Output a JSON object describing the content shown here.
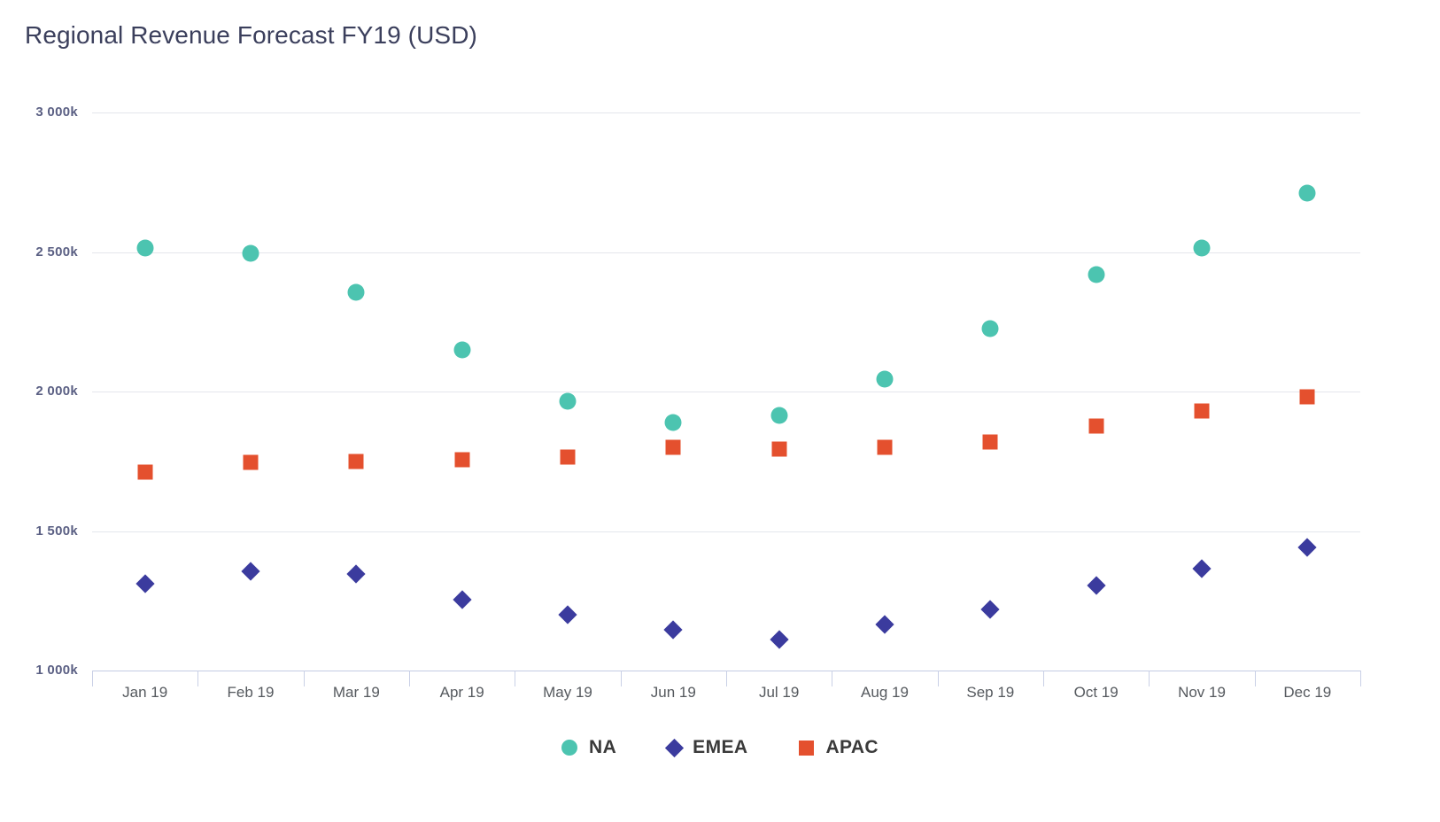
{
  "chart_data": {
    "type": "scatter",
    "title": "Regional Revenue Forecast FY19 (USD)",
    "xlabel": "",
    "ylabel": "",
    "categories": [
      "Jan 19",
      "Feb 19",
      "Mar 19",
      "Apr 19",
      "May 19",
      "Jun 19",
      "Jul 19",
      "Aug 19",
      "Sep 19",
      "Oct 19",
      "Nov 19",
      "Dec 19"
    ],
    "ylim": [
      1000000,
      3000000
    ],
    "ytick_values": [
      3000000,
      2500000,
      2000000,
      1500000,
      1000000
    ],
    "ytick_labels": [
      "3 000k",
      "2 500k",
      "2 000k",
      "1 500k",
      "1 000k"
    ],
    "grid": true,
    "legend_position": "bottom",
    "series": [
      {
        "name": "NA",
        "color": "#4cc4b0",
        "marker": "circle",
        "values": [
          2515000,
          2495000,
          2355000,
          2150000,
          1965000,
          1890000,
          1915000,
          2045000,
          2225000,
          2420000,
          2515000,
          2710000
        ]
      },
      {
        "name": "EMEA",
        "color": "#3b3b9e",
        "marker": "diamond",
        "values": [
          1310000,
          1355000,
          1345000,
          1255000,
          1200000,
          1145000,
          1110000,
          1165000,
          1220000,
          1305000,
          1365000,
          1440000
        ]
      },
      {
        "name": "APAC",
        "color": "#e4502e",
        "marker": "square",
        "values": [
          1710000,
          1745000,
          1750000,
          1755000,
          1765000,
          1800000,
          1795000,
          1800000,
          1820000,
          1875000,
          1930000,
          1980000
        ]
      }
    ]
  },
  "legend": {
    "items": [
      {
        "label": "NA",
        "color": "#4cc4b0",
        "marker": "circle"
      },
      {
        "label": "EMEA",
        "color": "#3b3b9e",
        "marker": "diamond"
      },
      {
        "label": "APAC",
        "color": "#e4502e",
        "marker": "square"
      }
    ]
  }
}
